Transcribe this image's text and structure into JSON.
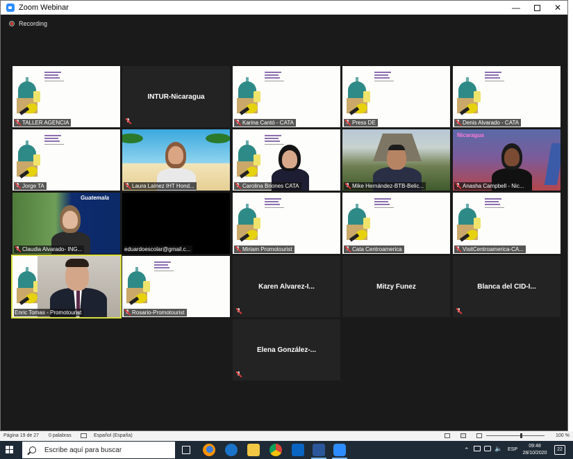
{
  "window": {
    "title": "Zoom Webinar",
    "minimize": "—",
    "close": "✕"
  },
  "recording": {
    "label": "Recording"
  },
  "tiles": [
    {
      "name": "TALLER AGENCIA",
      "type": "slide"
    },
    {
      "name": "INTUR-Nicaragua",
      "type": "name"
    },
    {
      "name": "Karina Cantó - CATA",
      "type": "slide"
    },
    {
      "name": "Press DE",
      "type": "slide"
    },
    {
      "name": "Denis Alvarado - CATA",
      "type": "slide"
    },
    {
      "name": "Jorge TA",
      "type": "slide"
    },
    {
      "name": "Laura Laínez IHT Hond...",
      "type": "video"
    },
    {
      "name": "Carolina Briones CATA",
      "type": "video"
    },
    {
      "name": "Mike Hernández-BTB-Belic...",
      "type": "video"
    },
    {
      "name": "Anasha Campbell - Nic...",
      "type": "video"
    },
    {
      "name": "Claudia Alvarado- ING...",
      "type": "video"
    },
    {
      "name": "eduardoescolar@gmail.c...",
      "type": "blank"
    },
    {
      "name": "Miriam Promotourist",
      "type": "slide"
    },
    {
      "name": "Cata Centroamerica",
      "type": "slide"
    },
    {
      "name": "VisitCentroamerica-CA...",
      "type": "slide"
    },
    {
      "name": "Enric Tomas - Promotourist",
      "type": "video"
    },
    {
      "name": "Rosario-Promotourist",
      "type": "slide"
    },
    {
      "name": "Karen  Alvarez-I...",
      "type": "name"
    },
    {
      "name": "Mitzy Funez",
      "type": "name"
    },
    {
      "name": "Blanca del CID-I...",
      "type": "name"
    },
    {
      "name": "Elena  González-...",
      "type": "name"
    }
  ],
  "tile_overlays": {
    "nicaragua_text": "Nicaragua",
    "guatemala_text": "Guatemala"
  },
  "statusbar": {
    "page": "Página 19 de 27",
    "words": "0 palabras",
    "language": "Español (España)",
    "zoom": "100 %"
  },
  "taskbar": {
    "search_placeholder": "Escribe aquí para buscar",
    "language": "ESP",
    "time": "09:48",
    "date": "28/10/2020",
    "notifications": "22"
  },
  "colors": {
    "active_speaker": "#d8df3e",
    "zoom_blue": "#2d8cff",
    "taskbar": "#1e2a36"
  }
}
